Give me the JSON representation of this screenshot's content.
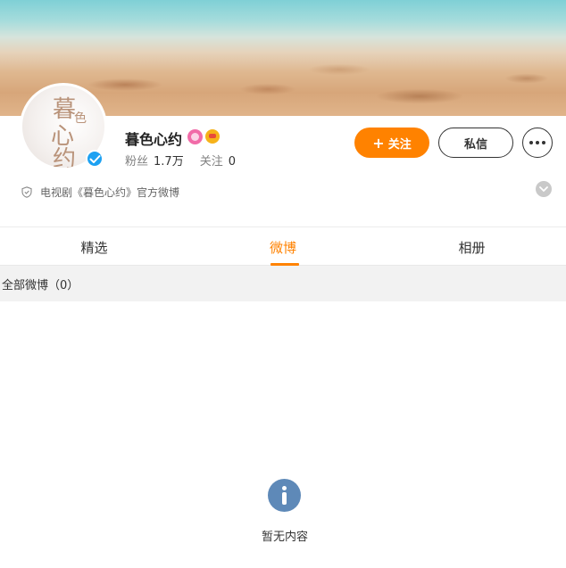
{
  "profile": {
    "name": "暮色心约",
    "avatar_text": [
      "暮",
      "色",
      "心",
      "约"
    ],
    "fans_label": "粉丝",
    "fans_count": "1.7万",
    "following_label": "关注",
    "following_count": "0",
    "description": "电视剧《暮色心约》官方微博",
    "verified": true
  },
  "actions": {
    "follow_label": "关注",
    "message_label": "私信"
  },
  "tabs": [
    {
      "label": "精选",
      "active": false
    },
    {
      "label": "微博",
      "active": true
    },
    {
      "label": "相册",
      "active": false
    }
  ],
  "filter": {
    "label": "全部微博（0）"
  },
  "empty_state": {
    "text": "暂无内容"
  },
  "colors": {
    "accent": "#ff8200",
    "verify": "#1da1f2",
    "empty_icon": "#5e89b8"
  },
  "icons": {
    "verified": "verified-check-icon",
    "more": "more-dots-icon",
    "shield": "shield-icon",
    "expand": "chevron-down-icon",
    "info": "info-icon"
  }
}
